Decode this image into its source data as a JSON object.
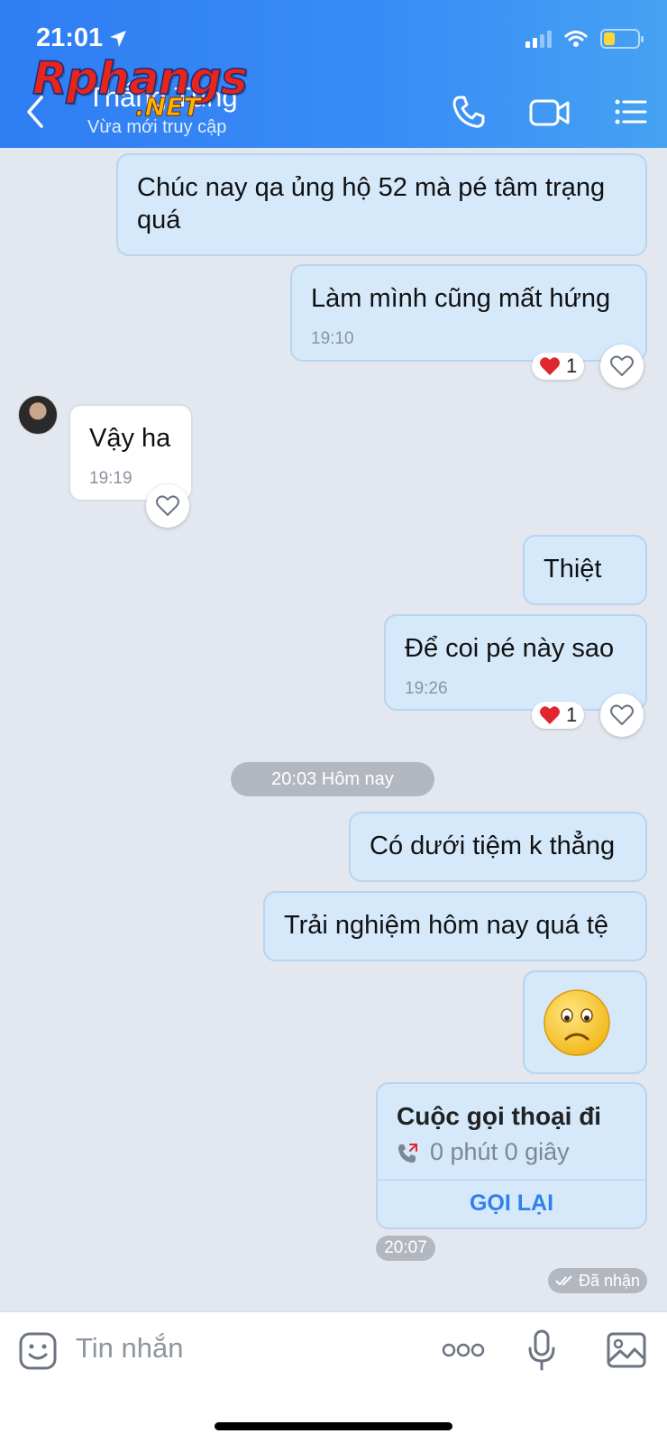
{
  "status_bar": {
    "time": "21:01"
  },
  "header": {
    "contact_name": "Thắng Tùng",
    "contact_status": "Vừa mới truy cập",
    "watermark": "Rphangs",
    "watermark_suffix": ".NET"
  },
  "messages": [
    {
      "direction": "out",
      "text_line1": "Chúc nay qa ủng hộ 52 mà pé tâm trạng",
      "text_line2": "quá"
    },
    {
      "direction": "out",
      "text": "Làm mình cũng mất hứng",
      "time": "19:10",
      "reaction": {
        "emoji": "heart",
        "count": "1"
      }
    },
    {
      "direction": "in",
      "text": "Vậy ha",
      "time": "19:19"
    },
    {
      "direction": "out",
      "text": "Thiệt"
    },
    {
      "direction": "out",
      "text": "Để coi pé này sao",
      "time": "19:26",
      "reaction": {
        "emoji": "heart",
        "count": "1"
      }
    },
    {
      "direction": "out",
      "text": "Có dưới tiệm k thẳng"
    },
    {
      "direction": "out",
      "text": "Trải nghiệm hôm nay quá tệ"
    },
    {
      "direction": "out",
      "sticker": "sad-face-emoji"
    }
  ],
  "date_separator": "20:03 Hôm nay",
  "call_card": {
    "title": "Cuộc gọi thoại đi",
    "duration": "0 phút 0 giây",
    "action": "GỌI LẠI",
    "time": "20:07"
  },
  "read_status": "Đã nhận",
  "input": {
    "placeholder": "Tin nhắn"
  },
  "colors": {
    "header_gradient_start": "#2f7df3",
    "header_gradient_end": "#45a2f3",
    "outgoing_bubble": "#d5e9fb",
    "incoming_bubble": "#ffffff",
    "chat_background": "#e2e7f0",
    "accent": "#2f80ed"
  }
}
